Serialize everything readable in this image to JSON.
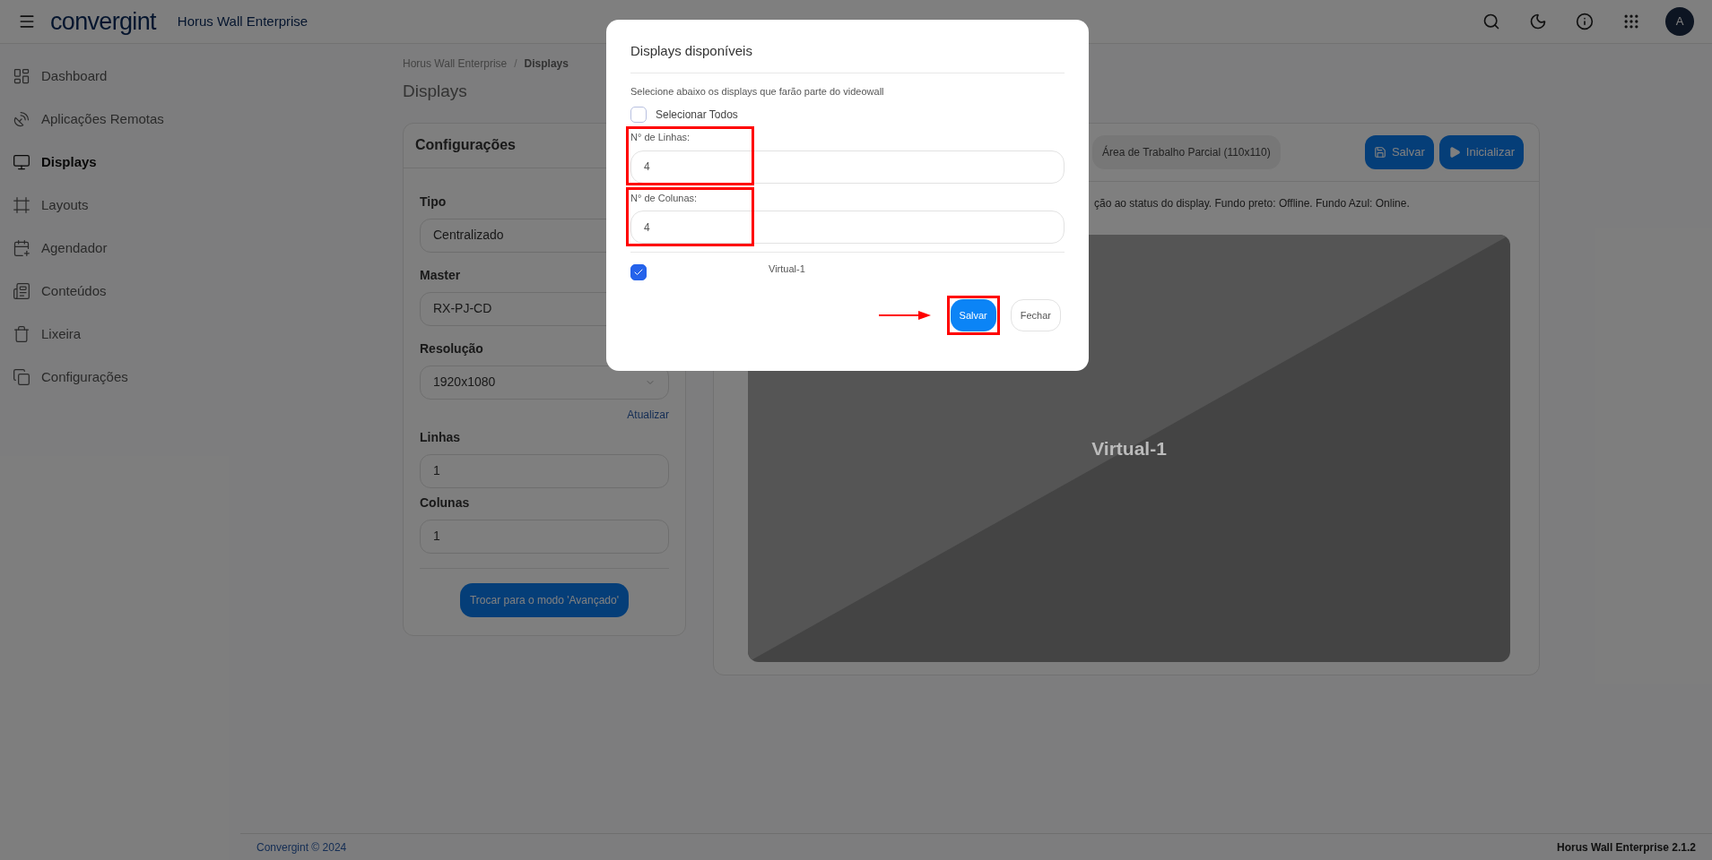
{
  "header": {
    "logo": "convergint",
    "app_title": "Horus Wall Enterprise",
    "avatar": "A"
  },
  "sidebar": {
    "items": [
      {
        "label": "Dashboard",
        "selected": false
      },
      {
        "label": "Aplicações Remotas",
        "selected": false
      },
      {
        "label": "Displays",
        "selected": true
      },
      {
        "label": "Layouts",
        "selected": false
      },
      {
        "label": "Agendador",
        "selected": false
      },
      {
        "label": "Conteúdos",
        "selected": false
      },
      {
        "label": "Lixeira",
        "selected": false
      },
      {
        "label": "Configurações",
        "selected": false
      }
    ]
  },
  "breadcrumb": {
    "items": [
      "Horus Wall Enterprise",
      "Displays"
    ],
    "separator": "/"
  },
  "page_title": "Displays",
  "config_card": {
    "title": "Configurações",
    "fields": [
      {
        "label": "Tipo",
        "value": "Centralizado",
        "kind": "input"
      },
      {
        "label": "Master",
        "value": "RX-PJ-CD",
        "kind": "input"
      },
      {
        "label": "Resolução",
        "value": "1920x1080",
        "kind": "select",
        "link": "Atualizar"
      },
      {
        "label": "Linhas",
        "value": "1",
        "kind": "input"
      },
      {
        "label": "Colunas",
        "value": "1",
        "kind": "input"
      }
    ],
    "button": "Trocar para o modo 'Avançado'"
  },
  "display_card": {
    "area_pill": "Área de Trabalho Parcial (110x110)",
    "buttons": [
      {
        "label": "Salvar",
        "kind": "save"
      },
      {
        "label": "Inicializar",
        "kind": "play"
      }
    ],
    "note": "ção ao status do display. Fundo preto: Offline. Fundo Azul: Online.",
    "displays": [
      {
        "name": "Virtual-1"
      }
    ]
  },
  "modal": {
    "title": "Displays disponíveis",
    "instruction": "Selecione abaixo os displays que farão parte do videowall",
    "select_all": {
      "label": "Selecionar Todos",
      "checked": false
    },
    "fields": [
      {
        "label": "N° de Linhas:",
        "value": "4",
        "highlighted": true
      },
      {
        "label": "N° de Colunas:",
        "value": "4",
        "highlighted": true
      }
    ],
    "displays": [
      {
        "name": "Virtual-1",
        "checked": true
      }
    ],
    "buttons": [
      {
        "label": "Salvar",
        "kind": "primary",
        "highlighted": true
      },
      {
        "label": "Fechar",
        "kind": "secondary",
        "highlighted": false
      }
    ]
  },
  "footer": {
    "left": "Convergint © 2024",
    "right": "Horus Wall Enterprise 2.1.2"
  }
}
